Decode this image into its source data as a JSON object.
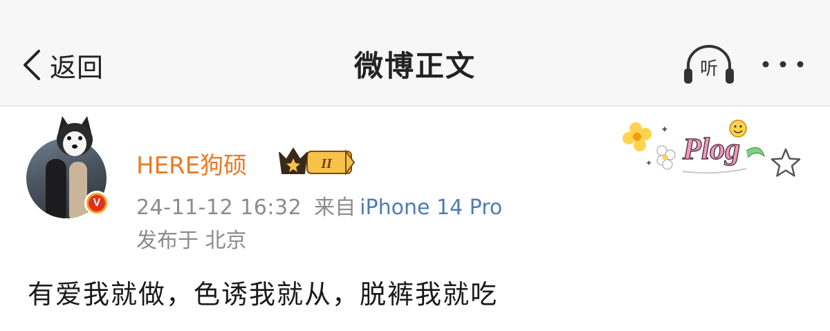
{
  "nav": {
    "back_label": "返回",
    "title": "微博正文",
    "listen_label": "听"
  },
  "post": {
    "author": {
      "name": "HERE狗硕",
      "verified_badge": "V",
      "vip_level": "II"
    },
    "date": "24-11-12 16:32",
    "source_prefix": "来自",
    "device": "iPhone 14 Pro",
    "location": "发布于 北京",
    "decoration_text": "Plog",
    "text": "有爱我就做，色诱我就从，脱裤我就吃"
  },
  "colors": {
    "username": "#eb7a24",
    "device_link": "#4f7cb0",
    "meta_gray": "#8b8b8b",
    "nav_bg": "#f7f7f7"
  },
  "icons": {
    "back": "chevron-left-icon",
    "listen": "headphones-icon",
    "more": "more-dots-icon",
    "favorite": "star-outline-icon",
    "vip": "crown-icon"
  }
}
